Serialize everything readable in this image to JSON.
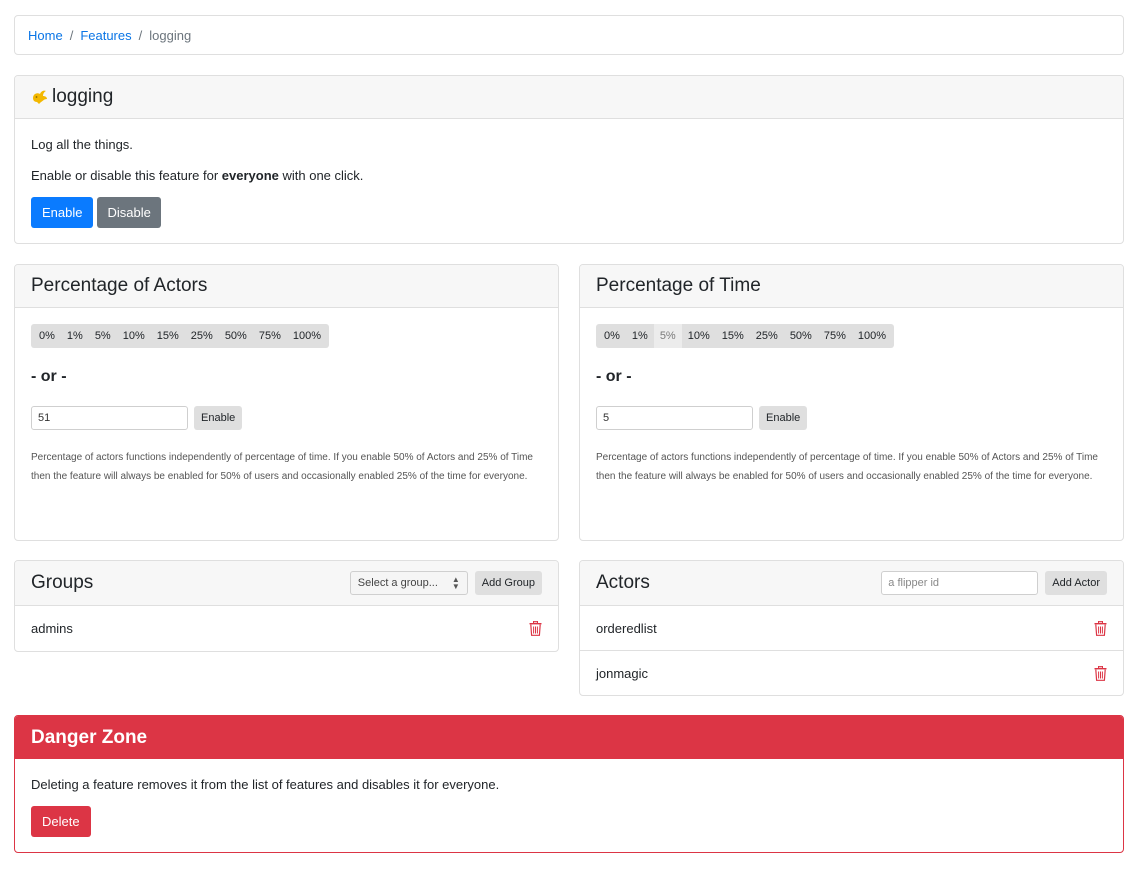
{
  "breadcrumb": {
    "home": "Home",
    "features": "Features",
    "current": "logging"
  },
  "feature": {
    "name": "logging",
    "description": "Log all the things.",
    "enable_text_prefix": "Enable or disable this feature for ",
    "enable_text_bold": "everyone",
    "enable_text_suffix": " with one click.",
    "enable_label": "Enable",
    "disable_label": "Disable"
  },
  "actors_pct": {
    "title": "Percentage of Actors",
    "options": [
      "0%",
      "1%",
      "5%",
      "10%",
      "15%",
      "25%",
      "50%",
      "75%",
      "100%"
    ],
    "or_text": "- or -",
    "value": "51",
    "enable_label": "Enable",
    "note": "Percentage of actors functions independently of percentage of time. If you enable 50% of Actors and 25% of Time then the feature will always be enabled for 50% of users and occasionally enabled 25% of the time for everyone."
  },
  "time_pct": {
    "title": "Percentage of Time",
    "options": [
      "0%",
      "1%",
      "5%",
      "10%",
      "15%",
      "25%",
      "50%",
      "75%",
      "100%"
    ],
    "active_option": "5%",
    "or_text": "- or -",
    "value": "5",
    "enable_label": "Enable",
    "note": "Percentage of actors functions independently of percentage of time. If you enable 50% of Actors and 25% of Time then the feature will always be enabled for 50% of users and occasionally enabled 25% of the time for everyone."
  },
  "groups": {
    "title": "Groups",
    "select_placeholder": "Select a group...",
    "add_label": "Add Group",
    "items": [
      "admins"
    ]
  },
  "actors": {
    "title": "Actors",
    "input_placeholder": "a flipper id",
    "add_label": "Add Actor",
    "items": [
      "orderedlist",
      "jonmagic"
    ]
  },
  "danger": {
    "title": "Danger Zone",
    "text": "Deleting a feature removes it from the list of features and disables it for everyone.",
    "delete_label": "Delete"
  },
  "colors": {
    "primary": "#0a7bff",
    "secondary": "#6c757d",
    "danger": "#dc3545",
    "link": "#0a75e6"
  },
  "icons": {
    "feature": "flipper-bird-icon",
    "delete": "trash-icon"
  }
}
